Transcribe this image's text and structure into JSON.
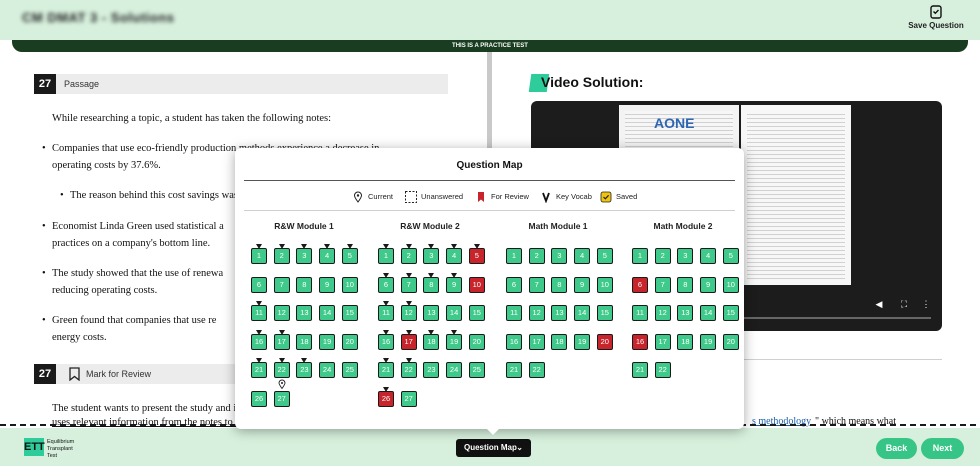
{
  "header": {
    "title": "CM DMAT 3 - Solutions",
    "save_label": "Save Question",
    "banner": "THIS IS A PRACTICE TEST"
  },
  "question": {
    "number": "27",
    "passage_label": "Passage",
    "intro": "While researching a topic, a student has taken the following notes:",
    "notes": [
      "Companies that use eco-friendly production methods experience a decrease in operating costs by 37.6%.",
      "The reason behind this cost savings was",
      "Economist Linda Green used statistical a practices on a company's bottom line.",
      "The study showed that the use of renewa reducing operating costs.",
      "Green found that companies that use re energy costs."
    ],
    "mark_label": "Mark for Review",
    "prompt_line1": "The student wants to present the study and it",
    "prompt_line2": "uses relevant information from the notes to a",
    "method_link": "s methodology",
    "method_rest": "\" which means what"
  },
  "video": {
    "title": "Video Solution:",
    "brand": "AONE"
  },
  "footer": {
    "logo": "ETT",
    "brand_name": "Equilibrium Transplant Test",
    "qmap_label": "Question Map",
    "back_label": "Back",
    "next_label": "Next"
  },
  "qmap": {
    "title": "Question Map",
    "legend": [
      "Current",
      "Unanswered",
      "For Review",
      "Key Vocab",
      "Saved"
    ],
    "colors": {
      "answered": "#3fc98a",
      "review": "#c7242b",
      "accent": "#36c587"
    },
    "modules": [
      {
        "name": "R&W Module 1",
        "count": 27,
        "review": [],
        "vocab": [
          1,
          2,
          3,
          4,
          5,
          11,
          16,
          17,
          21,
          22,
          23
        ],
        "current": 27
      },
      {
        "name": "R&W Module 2",
        "count": 27,
        "review": [
          5,
          10,
          17,
          26
        ],
        "vocab": [
          1,
          2,
          3,
          4,
          5,
          6,
          7,
          8,
          9,
          11,
          12,
          16,
          17,
          18,
          19,
          21,
          22,
          26
        ],
        "current": null
      },
      {
        "name": "Math Module 1",
        "count": 22,
        "review": [
          20
        ],
        "vocab": [],
        "current": null
      },
      {
        "name": "Math Module 2",
        "count": 22,
        "review": [
          6,
          16
        ],
        "vocab": [],
        "current": null
      }
    ]
  }
}
